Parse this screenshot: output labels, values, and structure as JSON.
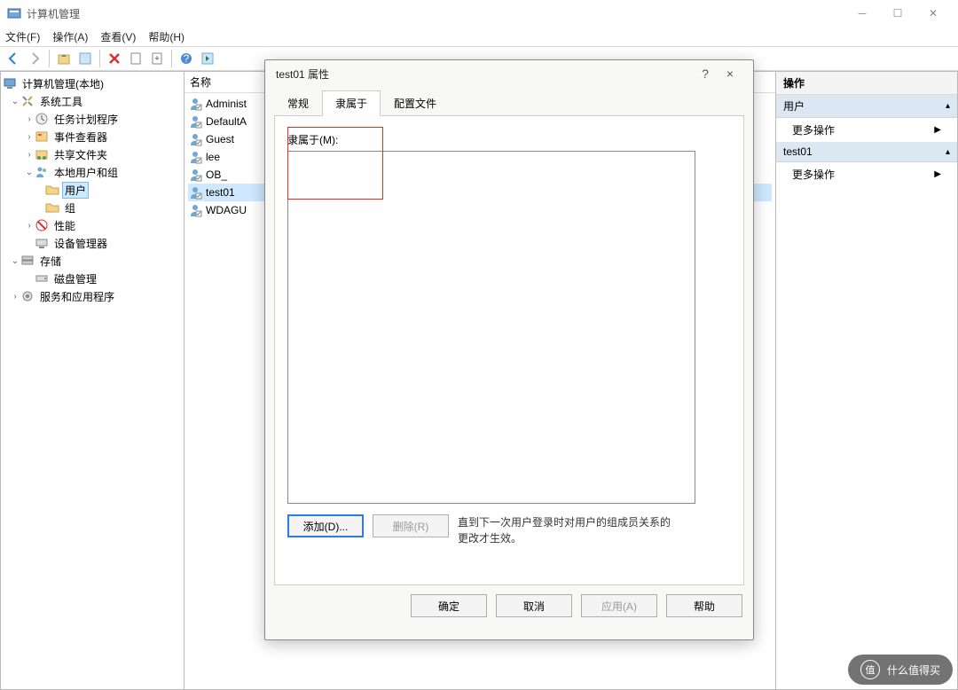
{
  "window": {
    "title": "计算机管理",
    "menus": [
      "文件(F)",
      "操作(A)",
      "查看(V)",
      "帮助(H)"
    ]
  },
  "tree": {
    "root": "计算机管理(本地)",
    "sys_tools": "系统工具",
    "task_sched": "任务计划程序",
    "event_viewer": "事件查看器",
    "shared": "共享文件夹",
    "local_users": "本地用户和组",
    "users": "用户",
    "groups": "组",
    "perf": "性能",
    "devmgr": "设备管理器",
    "storage": "存储",
    "diskmgmt": "磁盘管理",
    "services": "服务和应用程序"
  },
  "list": {
    "header": "名称",
    "items": [
      "Administ",
      "DefaultA",
      "Guest",
      "lee",
      "OB_",
      "test01",
      "WDAGU"
    ]
  },
  "actions": {
    "header": "操作",
    "group1": "用户",
    "more": "更多操作",
    "group2": "test01"
  },
  "dialog": {
    "title": "test01 属性",
    "help": "?",
    "close": "×",
    "tabs": [
      "常规",
      "隶属于",
      "配置文件"
    ],
    "member_label": "隶属于(M):",
    "add_btn": "添加(D)...",
    "remove_btn": "删除(R)",
    "note": "直到下一次用户登录时对用户的组成员关系的更改才生效。",
    "ok": "确定",
    "cancel": "取消",
    "apply": "应用(A)",
    "help_btn": "帮助"
  },
  "watermark": {
    "icon": "值",
    "text": "什么值得买"
  }
}
